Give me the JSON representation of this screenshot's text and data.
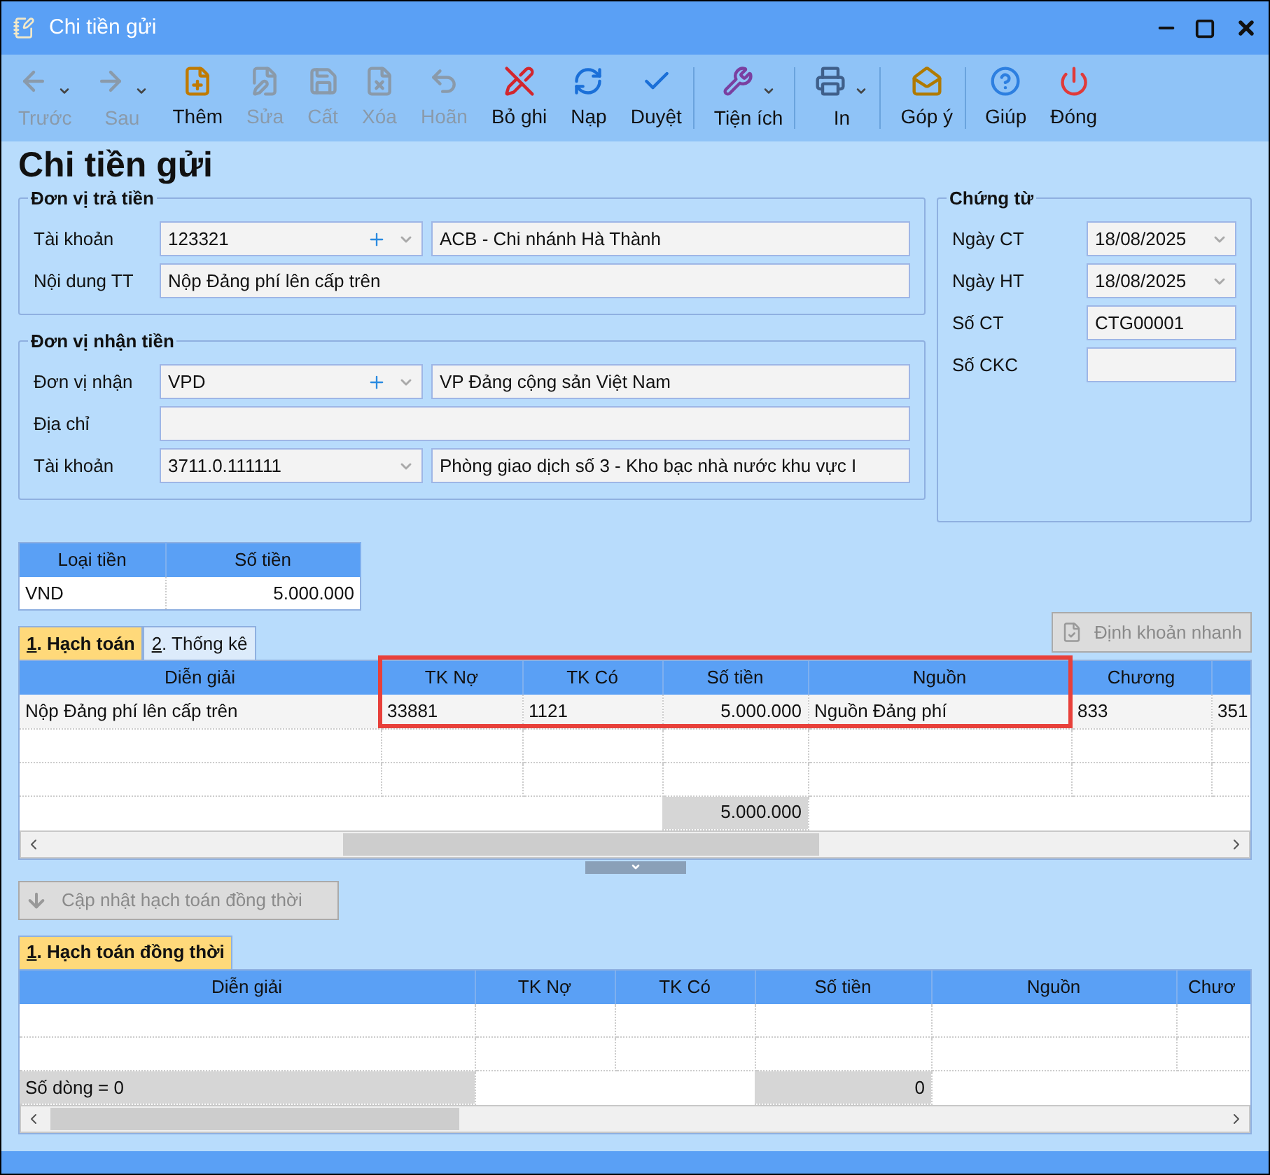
{
  "window": {
    "title": "Chi tiền gửi"
  },
  "toolbar": [
    {
      "label": "Trước",
      "disabled": true,
      "dropdown": true,
      "separator_after": false
    },
    {
      "label": "Sau",
      "disabled": true,
      "dropdown": true,
      "separator_after": false
    },
    {
      "label": "Thêm",
      "disabled": false,
      "dropdown": false,
      "separator_after": false
    },
    {
      "label": "Sửa",
      "disabled": true,
      "dropdown": false,
      "separator_after": false
    },
    {
      "label": "Cất",
      "disabled": true,
      "dropdown": false,
      "separator_after": false
    },
    {
      "label": "Xóa",
      "disabled": true,
      "dropdown": false,
      "separator_after": false
    },
    {
      "label": "Hoãn",
      "disabled": true,
      "dropdown": false,
      "separator_after": false
    },
    {
      "label": "Bỏ ghi",
      "disabled": false,
      "dropdown": false,
      "separator_after": false
    },
    {
      "label": "Nạp",
      "disabled": false,
      "dropdown": false,
      "separator_after": false
    },
    {
      "label": "Duyệt",
      "disabled": false,
      "dropdown": false,
      "separator_after": true
    },
    {
      "label": "Tiện ích",
      "disabled": false,
      "dropdown": true,
      "separator_after": true
    },
    {
      "label": "In",
      "disabled": false,
      "dropdown": true,
      "separator_after": true
    },
    {
      "label": "Góp ý",
      "disabled": false,
      "dropdown": false,
      "separator_after": true
    },
    {
      "label": "Giúp",
      "disabled": false,
      "dropdown": false,
      "separator_after": false
    },
    {
      "label": "Đóng",
      "disabled": false,
      "dropdown": false,
      "separator_after": false
    }
  ],
  "page_title": "Chi tiền gửi",
  "payer": {
    "title": "Đơn vị trả tiền",
    "fields": [
      {
        "kind": "combo_pair",
        "label": "Tài khoản",
        "value": "123321",
        "add": true,
        "name": "ACB - Chi nhánh Hà Thành"
      },
      {
        "kind": "text",
        "label": "Nội dung TT",
        "value": "Nộp Đảng phí lên cấp trên"
      }
    ]
  },
  "payee": {
    "title": "Đơn vị nhận tiền",
    "fields": [
      {
        "kind": "combo_pair",
        "label": "Đơn vị nhận",
        "value": "VPD",
        "add": true,
        "name": "VP Đảng cộng sản Việt Nam"
      },
      {
        "kind": "text",
        "label": "Địa chỉ"
      },
      {
        "kind": "combo_pair",
        "label": "Tài khoản",
        "value": "3711.0.111111",
        "add": false,
        "name": "Phòng giao dịch số 3 - Kho bạc nhà nước khu vực I"
      }
    ]
  },
  "voucher": {
    "title": "Chứng từ",
    "fields": [
      {
        "kind": "date",
        "label": "Ngày CT",
        "value": "18/08/2025"
      },
      {
        "kind": "date",
        "label": "Ngày HT",
        "value": "18/08/2025"
      },
      {
        "kind": "text",
        "label": "Số CT",
        "value": "CTG00001"
      },
      {
        "kind": "text",
        "label": "Số CKC"
      }
    ]
  },
  "currency": {
    "columns": [
      "Loại tiền",
      "Số tiền"
    ],
    "rows": [
      [
        "VND",
        "5.000.000"
      ]
    ]
  },
  "entry_tabs": [
    {
      "label": "1. Hạch toán",
      "selected": true
    },
    {
      "label": "2. Thống kê",
      "selected": false
    }
  ],
  "quick_button": {
    "label": "Định khoản nhanh",
    "disabled": true
  },
  "entry_grid": {
    "columns": [
      "Diễn giải",
      "TK Nợ",
      "TK Có",
      "Số tiền",
      "Nguồn",
      "Chương"
    ],
    "rows": [
      [
        "Nộp Đảng phí lên cấp trên",
        "33881",
        "1121",
        "5.000.000",
        "Nguồn Đảng phí",
        "833",
        "351"
      ]
    ],
    "total": "5.000.000"
  },
  "update_button": {
    "label": "Cập nhật hạch toán đồng thời",
    "disabled": true
  },
  "sub_tabs": [
    {
      "label": "1. Hạch toán đồng thời",
      "selected": true
    }
  ],
  "sub_grid": {
    "columns": [
      "Diễn giải",
      "TK Nợ",
      "TK Có",
      "Số tiền",
      "Nguồn",
      "Chươ"
    ],
    "row_count": "Số dòng = 0",
    "total": "0"
  }
}
